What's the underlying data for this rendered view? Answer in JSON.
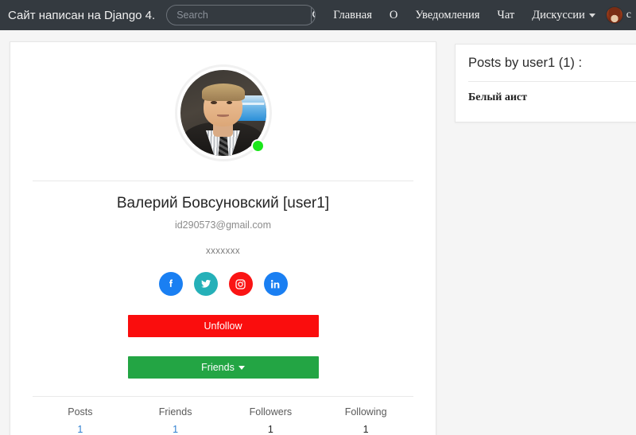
{
  "navbar": {
    "brand": "Сайт написан на Django 4.",
    "search": {
      "placeholder": "Search",
      "value": "",
      "icon": "search-icon"
    },
    "links": [
      {
        "label": "Главная",
        "has_caret": false
      },
      {
        "label": "О",
        "has_caret": false
      },
      {
        "label": "Уведомления",
        "has_caret": false
      },
      {
        "label": "Чат",
        "has_caret": false
      },
      {
        "label": "Дискуссии",
        "has_caret": true
      }
    ],
    "user": {
      "avatar_icon": "user-avatar-icon",
      "name": "c"
    },
    "bg_color": "#343a40"
  },
  "profile": {
    "avatar_icon": "profile-photo",
    "status": "online",
    "status_color": "#1ae61a",
    "name": "Валерий Бовсуновский [user1]",
    "email": "id290573@gmail.com",
    "extra": "xxxxxxx",
    "socials": [
      {
        "name": "facebook-icon",
        "color": "#1a7ff2"
      },
      {
        "name": "twitter-icon",
        "color": "#25b0b8"
      },
      {
        "name": "instagram-icon",
        "color": "#fa1414"
      },
      {
        "name": "linkedin-icon",
        "color": "#1a7ff2"
      }
    ],
    "unfollow_label": "Unfollow",
    "unfollow_color": "#fa0d0d",
    "friends_label": "Friends",
    "friends_color": "#23a544",
    "stats": [
      {
        "label": "Posts",
        "value": "1",
        "is_link": true
      },
      {
        "label": "Friends",
        "value": "1",
        "is_link": true
      },
      {
        "label": "Followers",
        "value": "1",
        "is_link": false
      },
      {
        "label": "Following",
        "value": "1",
        "is_link": false
      }
    ]
  },
  "posts_panel": {
    "title": "Posts by user1 (1) :",
    "items": [
      {
        "title": "Белый аист"
      }
    ]
  }
}
